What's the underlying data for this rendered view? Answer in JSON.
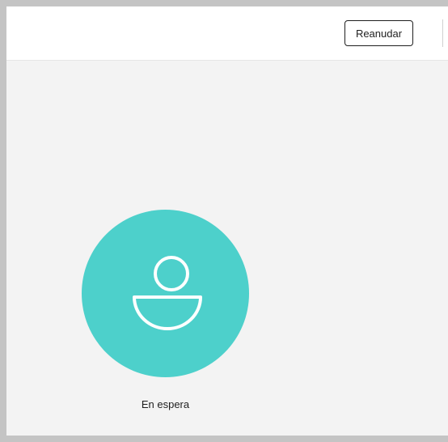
{
  "toolbar": {
    "resume_label": "Reanudar"
  },
  "participant": {
    "status": "En espera",
    "avatar_icon": "person-icon",
    "avatar_color": "#4dd0cb"
  }
}
